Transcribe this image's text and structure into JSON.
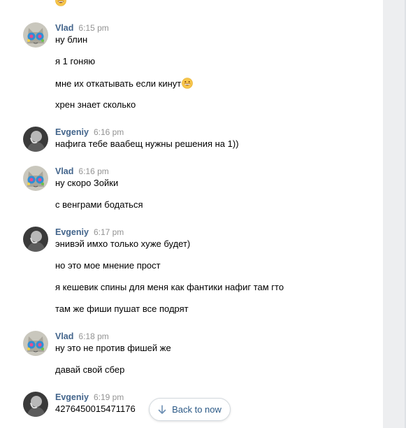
{
  "conversation": {
    "groups": [
      {
        "author": "Vlad",
        "time": "6:15 pm",
        "avatar": "cat-avatar",
        "messages": [
          {
            "text": "ну блин",
            "emoji": false
          },
          {
            "text": "я 1 гоняю",
            "emoji": false
          },
          {
            "text": "мне их откатывать если кинут",
            "emoji": true
          },
          {
            "text": "хрен знает сколько",
            "emoji": false
          }
        ]
      },
      {
        "author": "Evgeniy",
        "time": "6:16 pm",
        "avatar": "person-avatar",
        "messages": [
          {
            "text": "нафига тебе ваабещ нужны решения на 1))",
            "emoji": false
          }
        ]
      },
      {
        "author": "Vlad",
        "time": "6:16 pm",
        "avatar": "cat-avatar",
        "messages": [
          {
            "text": "ну скоро Зойки",
            "emoji": false
          },
          {
            "text": "с венграми бодаться",
            "emoji": false
          }
        ]
      },
      {
        "author": "Evgeniy",
        "time": "6:17 pm",
        "avatar": "person-avatar",
        "messages": [
          {
            "text": "энивэй имхо только хуже будет)",
            "emoji": false
          },
          {
            "text": "но это мое мнение прост",
            "emoji": false
          },
          {
            "text": "я кешевик спины для меня как фантики нафиг там гто",
            "emoji": false
          },
          {
            "text": "там же фиши пушат все подрят",
            "emoji": false
          }
        ]
      },
      {
        "author": "Vlad",
        "time": "6:18 pm",
        "avatar": "cat-avatar",
        "messages": [
          {
            "text": "ну это не против фишей же",
            "emoji": false
          },
          {
            "text": "давай свой сбер",
            "emoji": false
          }
        ]
      },
      {
        "author": "Evgeniy",
        "time": "6:19 pm",
        "avatar": "person-avatar",
        "messages": [
          {
            "text": "4276450015471176",
            "emoji": false
          }
        ]
      }
    ]
  },
  "back_button": {
    "label": "Back to now",
    "icon": "arrow-down-icon"
  },
  "colors": {
    "author": "#42648b",
    "time": "#939393",
    "link": "#2a5885",
    "panel": "#edeef0"
  }
}
